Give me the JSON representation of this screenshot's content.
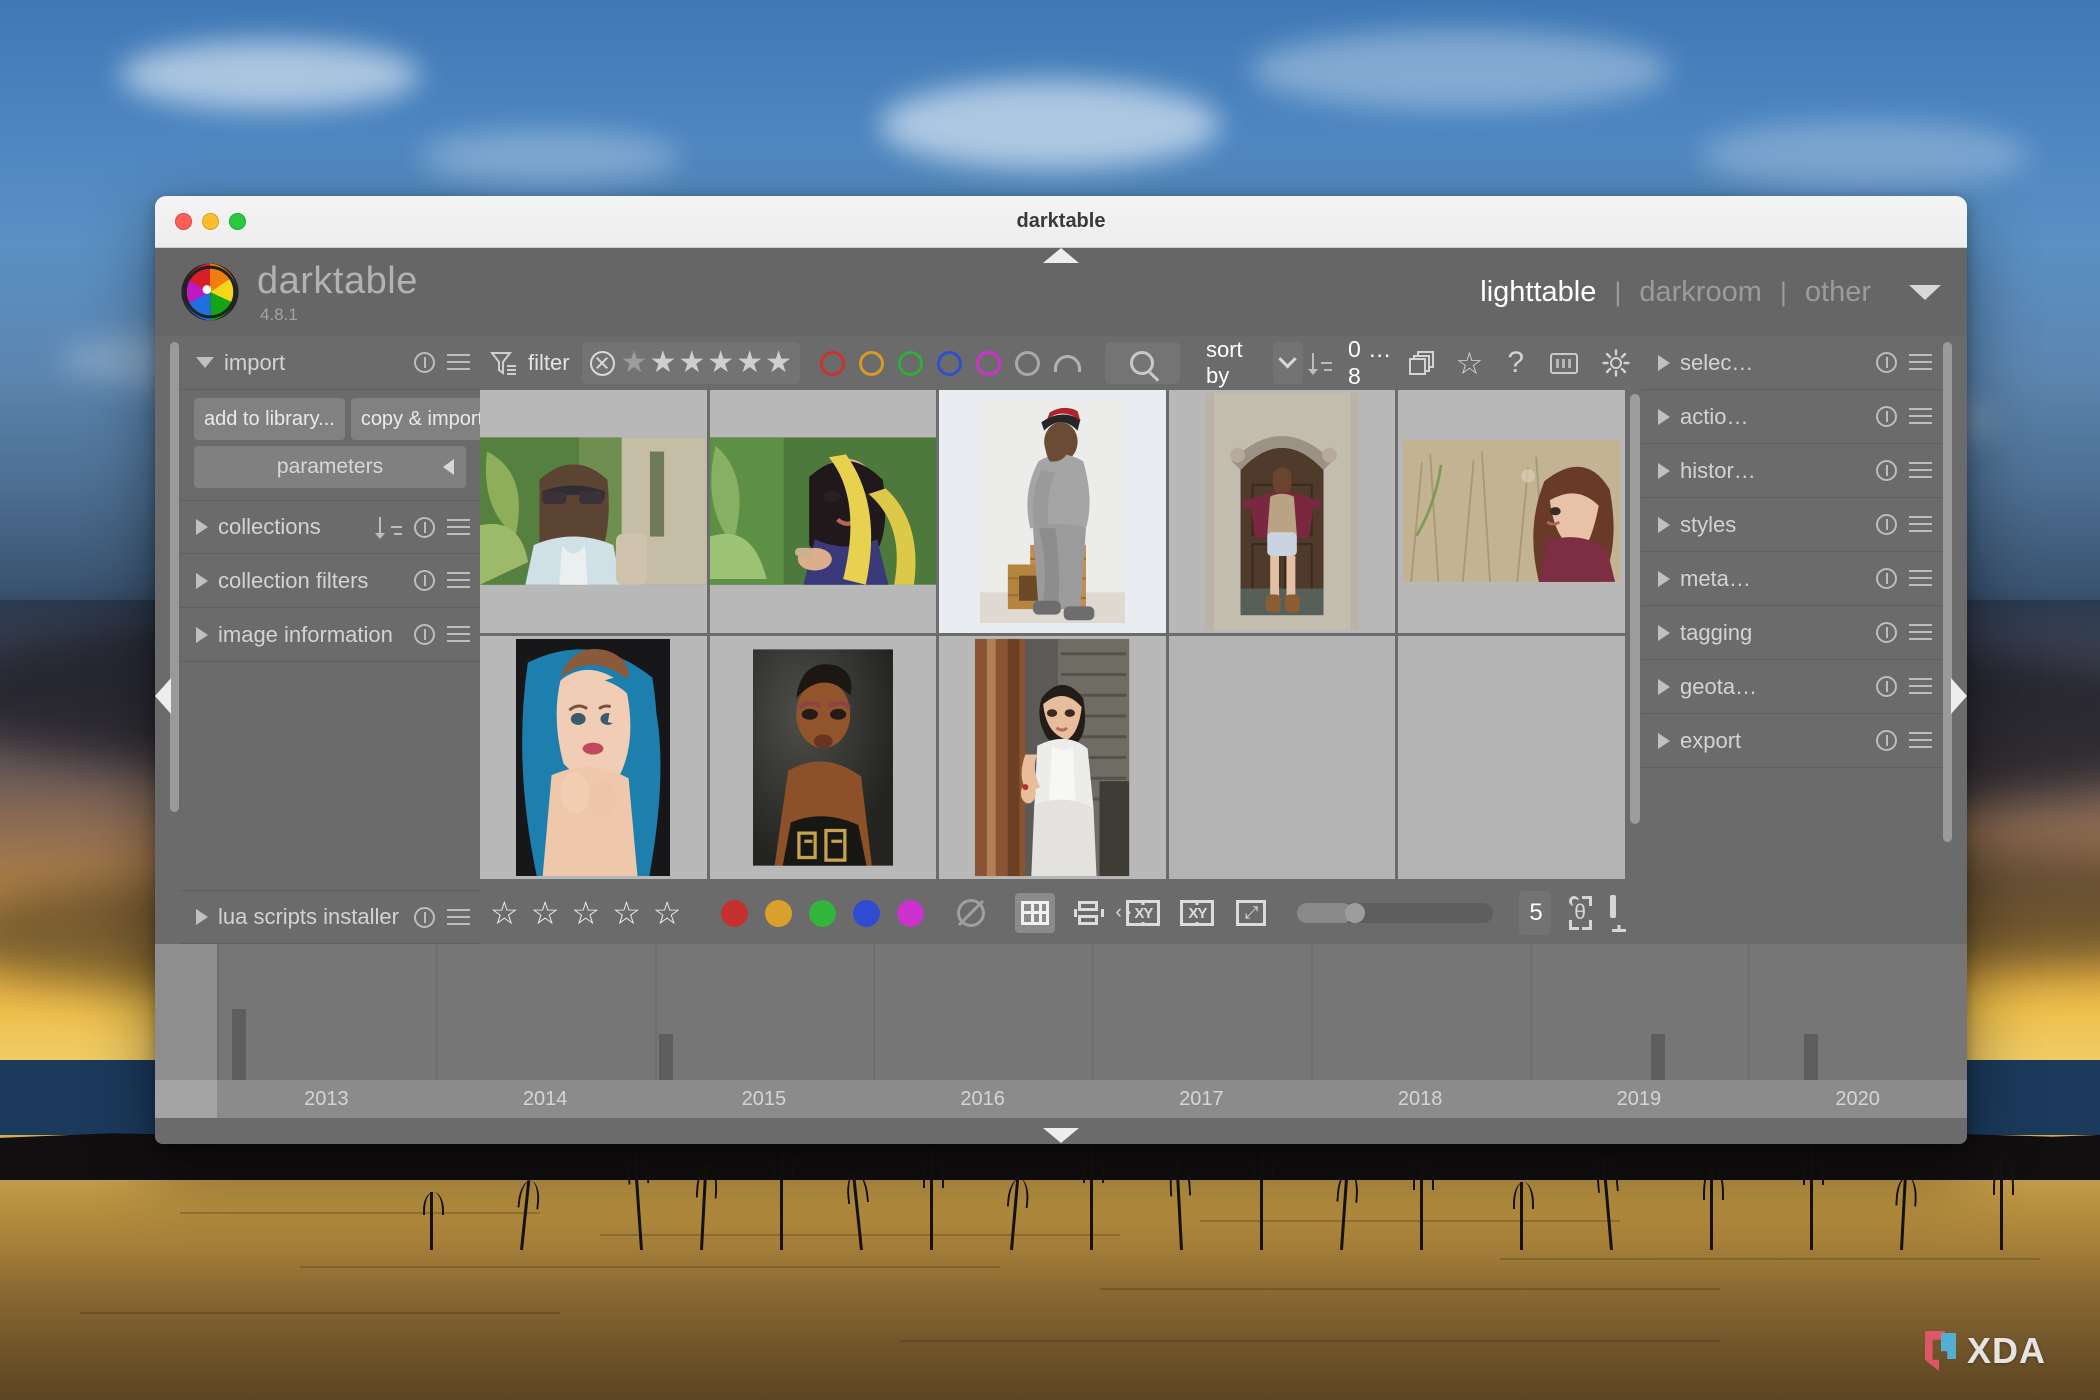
{
  "window": {
    "title": "darktable",
    "traffic_lights": [
      "close",
      "minimize",
      "zoom"
    ]
  },
  "header": {
    "app_name": "darktable",
    "version": "4.8.1",
    "views": [
      {
        "label": "lighttable",
        "active": true
      },
      {
        "label": "darkroom",
        "active": false
      },
      {
        "label": "other",
        "active": false
      }
    ],
    "view_separator": "|"
  },
  "left_panel": {
    "import": {
      "label": "import",
      "expanded": true,
      "buttons": [
        {
          "label": "add to library..."
        },
        {
          "label": "copy & import..."
        }
      ],
      "parameters_label": "parameters"
    },
    "modules": [
      {
        "label": "collections",
        "expanded": false,
        "has_sort": true
      },
      {
        "label": "collection filters",
        "expanded": false,
        "has_sort": false
      },
      {
        "label": "image information",
        "expanded": false,
        "has_sort": false
      }
    ],
    "bottom_module": {
      "label": "lua scripts installer",
      "expanded": false
    }
  },
  "filter_bar": {
    "filter_label": "filter",
    "rating_stars": 5,
    "reject_icon": "reject-icon",
    "color_labels": [
      "#c9342f",
      "#d79a24",
      "#2fae3c",
      "#2f4fd0",
      "#cc33cc",
      "#a8a8a8"
    ],
    "arc_icon": "arc-icon",
    "search_icon": "search-icon",
    "sort_by_label": "sort by",
    "sort_direction_icon": "sort-descending-icon",
    "range_label": "0 ... 8",
    "stack_icon": "image-stack-icon",
    "star_icon": "star-icon",
    "help_label": "?",
    "keyboard_icon": "keyboard-icon",
    "gear_icon": "gear-icon"
  },
  "grid": {
    "columns": 5,
    "rows": 2,
    "cells": [
      {
        "id": 1,
        "selected": false,
        "orientation": "landscape",
        "subject": "woman-sunglasses-palms"
      },
      {
        "id": 2,
        "selected": false,
        "orientation": "landscape",
        "subject": "woman-yellow-leaves"
      },
      {
        "id": 3,
        "selected": true,
        "orientation": "portrait",
        "subject": "man-on-crates"
      },
      {
        "id": 4,
        "selected": false,
        "orientation": "portrait",
        "subject": "woman-at-wooden-door"
      },
      {
        "id": 5,
        "selected": false,
        "orientation": "landscape",
        "subject": "woman-in-field"
      },
      {
        "id": 6,
        "selected": false,
        "orientation": "portrait",
        "subject": "woman-blue-headscarf"
      },
      {
        "id": 7,
        "selected": false,
        "orientation": "portrait",
        "subject": "woman-dark-background"
      },
      {
        "id": 8,
        "selected": false,
        "orientation": "portrait",
        "subject": "woman-white-top-doorway"
      },
      {
        "id": 9,
        "selected": false,
        "orientation": "empty",
        "subject": ""
      },
      {
        "id": 10,
        "selected": false,
        "orientation": "empty",
        "subject": ""
      }
    ]
  },
  "bottom_bar": {
    "rating_stars": 5,
    "color_labels": [
      "#c5312c",
      "#d9a12c",
      "#33b43a",
      "#2f4bd2",
      "#cc33cc"
    ],
    "clear_label_icon": "clear-color-label-icon",
    "layout_modes": [
      {
        "name": "filemanager",
        "icon": "grid-layout-icon",
        "active": true
      },
      {
        "name": "zoomable",
        "icon": "culling-layout-icon",
        "active": false
      },
      {
        "name": "culling-dynamic",
        "icon": "culling-dynamic-icon",
        "active": false
      },
      {
        "name": "culling-fixed",
        "icon": "culling-fixed-icon",
        "active": false
      },
      {
        "name": "fullpreview",
        "icon": "full-preview-icon",
        "active": false
      }
    ],
    "zoom_value": "5",
    "focus_icon": "focus-detection-icon",
    "display_icon": "display-profile-icon"
  },
  "right_panel": {
    "modules": [
      {
        "label": "selec…",
        "expanded": false
      },
      {
        "label": "actio…",
        "expanded": false
      },
      {
        "label": "histor…",
        "expanded": false
      },
      {
        "label": "styles",
        "expanded": false
      },
      {
        "label": "meta…",
        "expanded": false
      },
      {
        "label": "tagging",
        "expanded": false
      },
      {
        "label": "geota…",
        "expanded": false
      },
      {
        "label": "export",
        "expanded": false
      }
    ]
  },
  "timeline": {
    "years": [
      "2013",
      "2014",
      "2015",
      "2016",
      "2017",
      "2018",
      "2019",
      "2020"
    ],
    "bars": [
      {
        "year": "2013",
        "position": 0.04,
        "height": 0.52
      },
      {
        "year": "2015",
        "position": 0.02,
        "height": 0.38
      },
      {
        "year": "2019",
        "position": 0.55,
        "height": 0.38
      },
      {
        "year": "2020",
        "position": 0.25,
        "height": 0.38
      }
    ]
  },
  "watermark": {
    "text": "XDA"
  }
}
